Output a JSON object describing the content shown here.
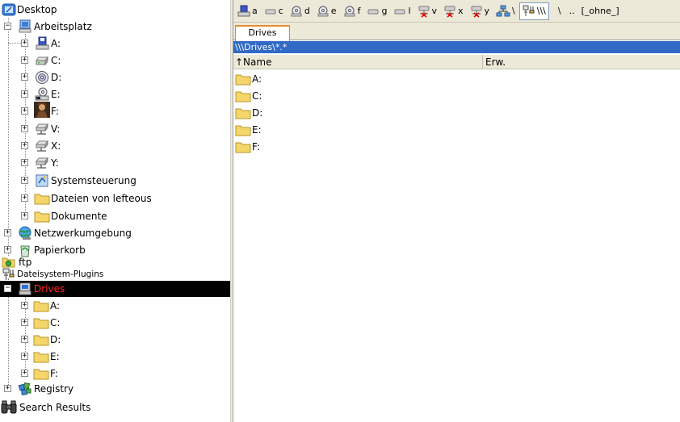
{
  "tree": {
    "desktop": "Desktop",
    "arbeitsplatz": "Arbeitsplatz",
    "drive_a": "A:",
    "drive_c": "C:",
    "drive_d": "D:",
    "drive_e": "E:",
    "drive_f": "F:",
    "drive_v": "V:",
    "drive_x": "X:",
    "drive_y": "Y:",
    "systemsteuerung": "Systemsteuerung",
    "dateien": "Dateien von lefteous",
    "dokumente": "Dokumente",
    "netzwerk": "Netzwerkumgebung",
    "papierkorb": "Papierkorb",
    "ftp": "ftp",
    "plugins": "Dateisystem-Plugins",
    "drives": "Drives",
    "drives_a": "A:",
    "drives_c": "C:",
    "drives_d": "D:",
    "drives_e": "E:",
    "drives_f": "F:",
    "registry": "Registry",
    "search": "Search Results"
  },
  "drivebar": {
    "a": "a",
    "c": "c",
    "d": "d",
    "e": "e",
    "f": "f",
    "g": "g",
    "l": "l",
    "v": "v",
    "x": "x",
    "y": "y",
    "net": "\\",
    "plugins": "\\\\\\",
    "root": "\\",
    "parent": "..",
    "none": "[_ohne_]"
  },
  "tab": {
    "label": "Drives"
  },
  "path": "\\\\\\Drives\\*.*",
  "columns": {
    "name": "↑Name",
    "ext": "Erw."
  },
  "files": [
    "A:",
    "C:",
    "D:",
    "E:",
    "F:"
  ],
  "colors": {
    "selection": "#000000",
    "selected_text": "#ff2a2a",
    "path_bg": "#316ac5",
    "folder": "#f5d66a"
  }
}
